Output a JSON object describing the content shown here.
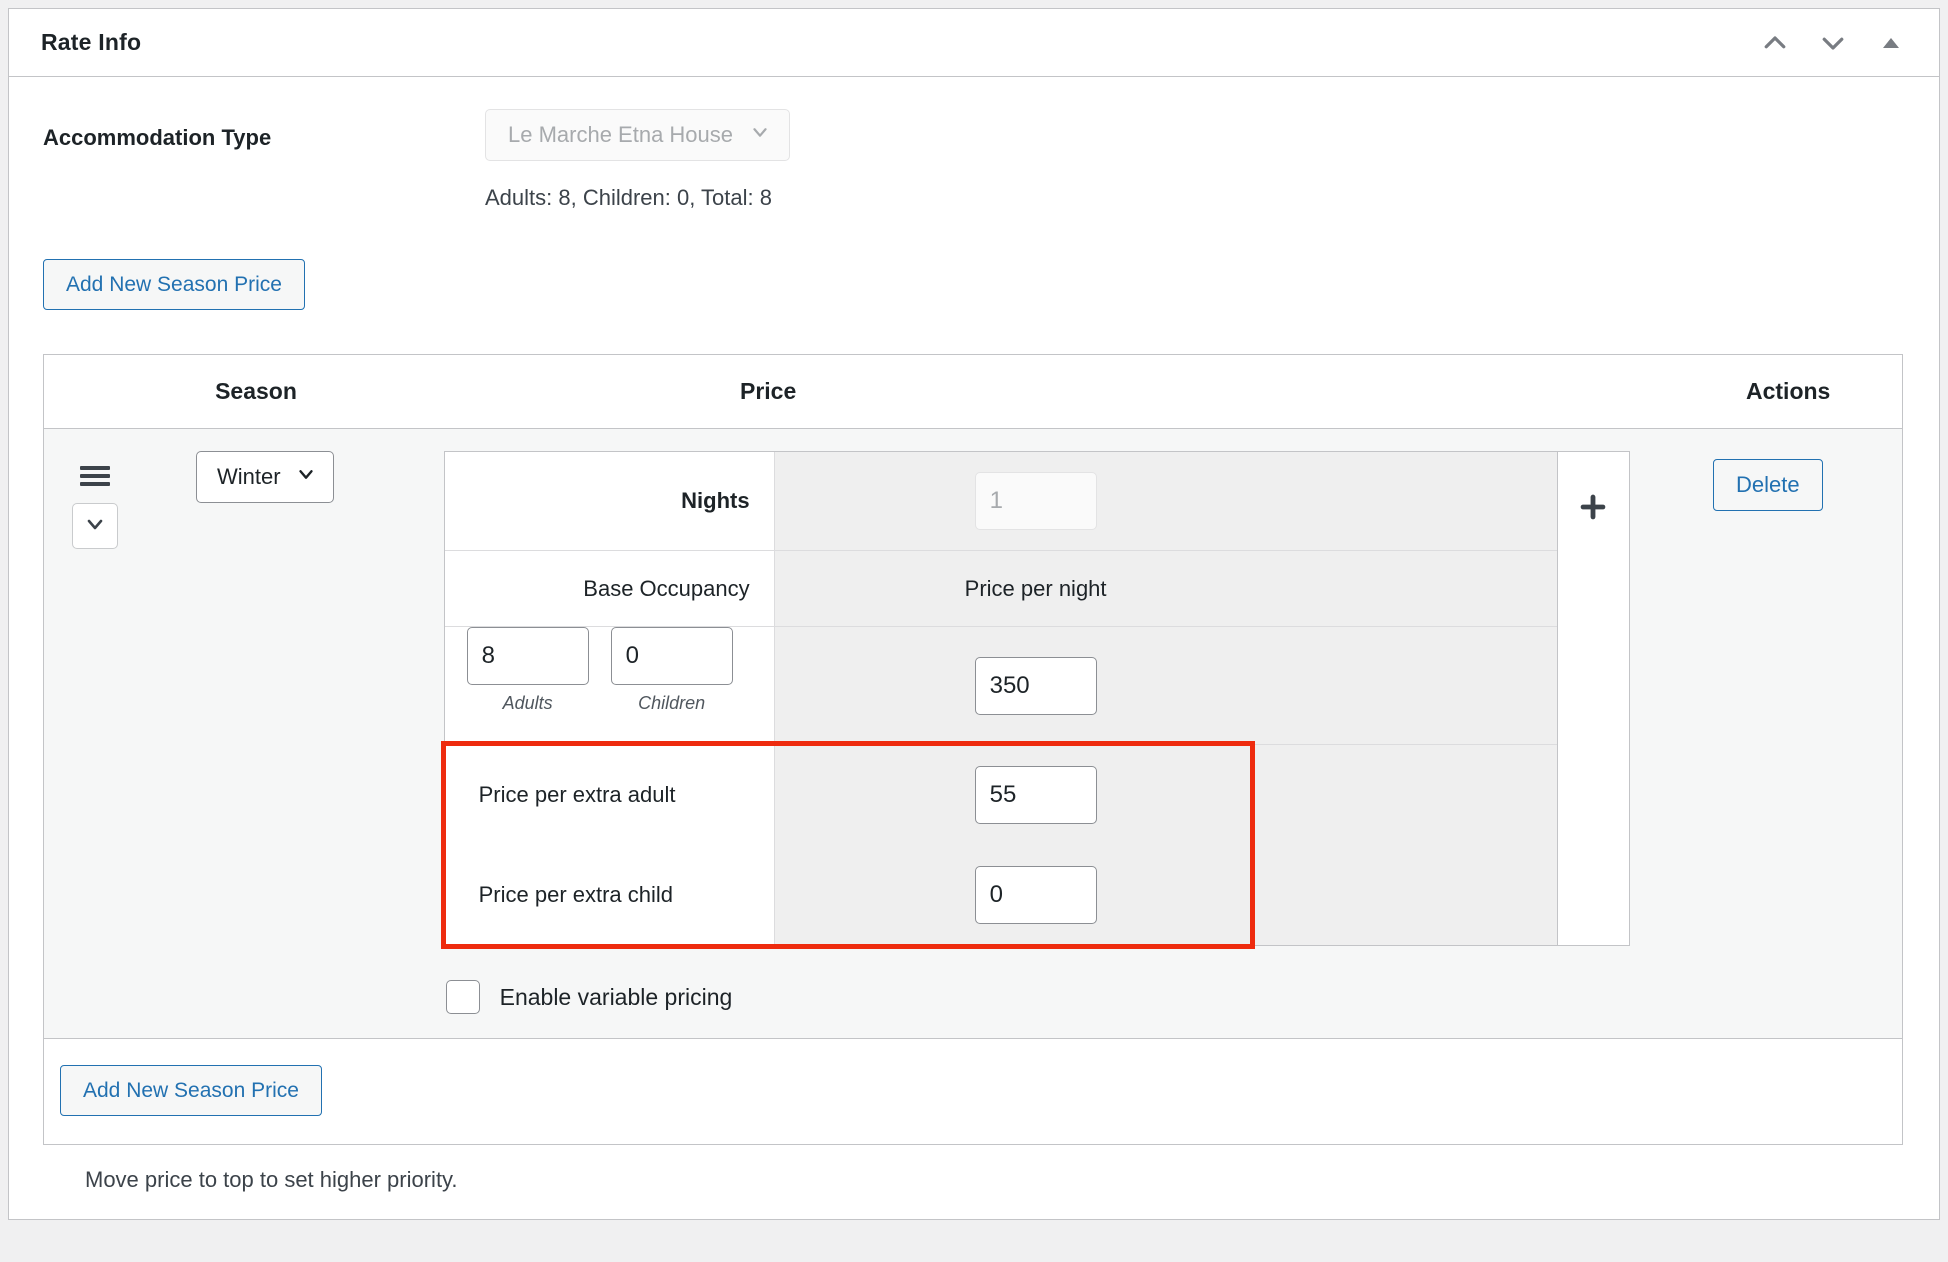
{
  "header": {
    "title": "Rate Info",
    "actions": [
      {
        "name": "move-up-icon",
        "label": "Move up"
      },
      {
        "name": "move-down-icon",
        "label": "Move down"
      },
      {
        "name": "toggle-panel-icon",
        "label": "Toggle panel"
      }
    ]
  },
  "accommodation": {
    "label": "Accommodation Type",
    "selected": "Le Marche Etna House",
    "meta": "Adults: 8, Children: 0, Total: 8"
  },
  "buttons": {
    "add_new_season_price_top": "Add New Season Price",
    "add_new_season_price_bottom": "Add New Season Price",
    "delete": "Delete"
  },
  "table": {
    "headers": {
      "season": "Season",
      "price": "Price",
      "actions": "Actions"
    },
    "rows": [
      {
        "season": "Winter",
        "nights_label": "Nights",
        "nights_value": "1",
        "base_occupancy_label": "Base Occupancy",
        "price_per_night_label": "Price per night",
        "adults_value": "8",
        "adults_caption": "Adults",
        "children_value": "0",
        "children_caption": "Children",
        "price_per_night_value": "350",
        "extra_adult_label": "Price per extra adult",
        "extra_adult_value": "55",
        "extra_child_label": "Price per extra child",
        "extra_child_value": "0",
        "variable_pricing_label": "Enable variable pricing",
        "variable_pricing_checked": false,
        "add_column_icon": "plus-icon"
      }
    ]
  },
  "footer": {
    "helper_text": "Move price to top to set higher priority."
  },
  "colors": {
    "accent_blue": "#2271b1",
    "highlight_red": "#ee2b0e",
    "panel_border": "#c3c4c7",
    "row_background": "#f6f7f7",
    "price_cell_background": "#efefef"
  }
}
